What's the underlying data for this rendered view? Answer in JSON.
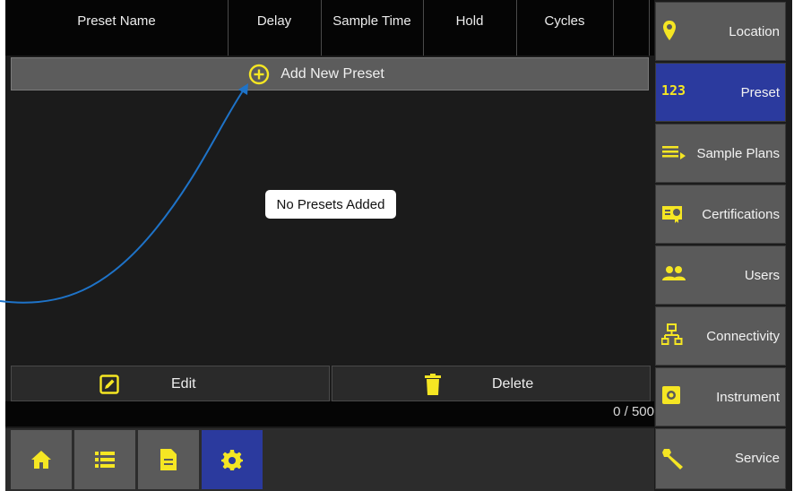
{
  "table": {
    "columns": [
      "Preset Name",
      "Delay",
      "Sample Time",
      "Hold",
      "Cycles"
    ],
    "add_label": "Add New Preset",
    "empty_message": "No Presets Added"
  },
  "actions": {
    "edit_label": "Edit",
    "delete_label": "Delete"
  },
  "counter": "0 / 500",
  "sidebar": {
    "items": [
      {
        "label": "Location",
        "icon": "location-pin-icon",
        "active": false
      },
      {
        "label": "Preset",
        "icon": "123-numbers-icon",
        "active": true
      },
      {
        "label": "Sample Plans",
        "icon": "list-arrow-icon",
        "active": false
      },
      {
        "label": "Certifications",
        "icon": "certificate-icon",
        "active": false
      },
      {
        "label": "Users",
        "icon": "users-icon",
        "active": false
      },
      {
        "label": "Connectivity",
        "icon": "network-icon",
        "active": false
      },
      {
        "label": "Instrument",
        "icon": "instrument-icon",
        "active": false
      },
      {
        "label": "Service",
        "icon": "wrench-icon",
        "active": false
      }
    ],
    "preset_icon_text": "123"
  },
  "bottom_nav": [
    {
      "icon": "home-icon",
      "active": false
    },
    {
      "icon": "list-icon",
      "active": false
    },
    {
      "icon": "document-icon",
      "active": false
    },
    {
      "icon": "settings-gear-icon",
      "active": true
    }
  ],
  "colors": {
    "accent_yellow": "#f5e623",
    "active_blue": "#2b3a9e",
    "annotation_arrow": "#1e73c8"
  }
}
